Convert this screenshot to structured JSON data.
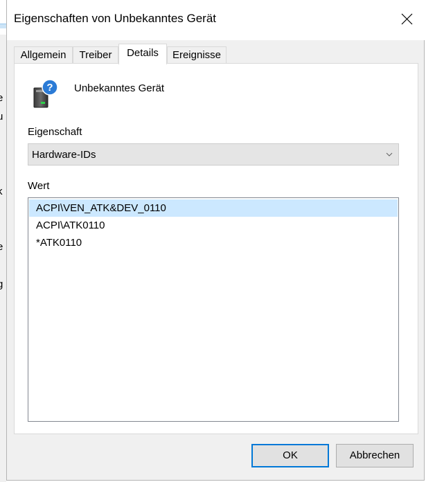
{
  "background": {
    "chars": [
      "e",
      "u",
      "k",
      "l",
      "e",
      "g"
    ]
  },
  "dialog": {
    "title": "Eigenschaften von Unbekanntes Gerät",
    "close_icon": "close-icon"
  },
  "tabs": [
    {
      "label": "Allgemein",
      "active": false
    },
    {
      "label": "Treiber",
      "active": false
    },
    {
      "label": "Details",
      "active": true
    },
    {
      "label": "Ereignisse",
      "active": false
    }
  ],
  "details": {
    "device_icon": "unknown-device-icon",
    "device_name": "Unbekanntes Gerät",
    "property_label": "Eigenschaft",
    "property_selected": "Hardware-IDs",
    "value_label": "Wert",
    "values": [
      "ACPI\\VEN_ATK&DEV_0110",
      "ACPI\\ATK0110",
      "*ATK0110"
    ],
    "selected_value_index": 0
  },
  "buttons": {
    "ok": "OK",
    "cancel": "Abbrechen"
  },
  "colors": {
    "selection": "#cce8ff",
    "default_button_border": "#0078d7",
    "question_badge": "#2b7bd6"
  }
}
